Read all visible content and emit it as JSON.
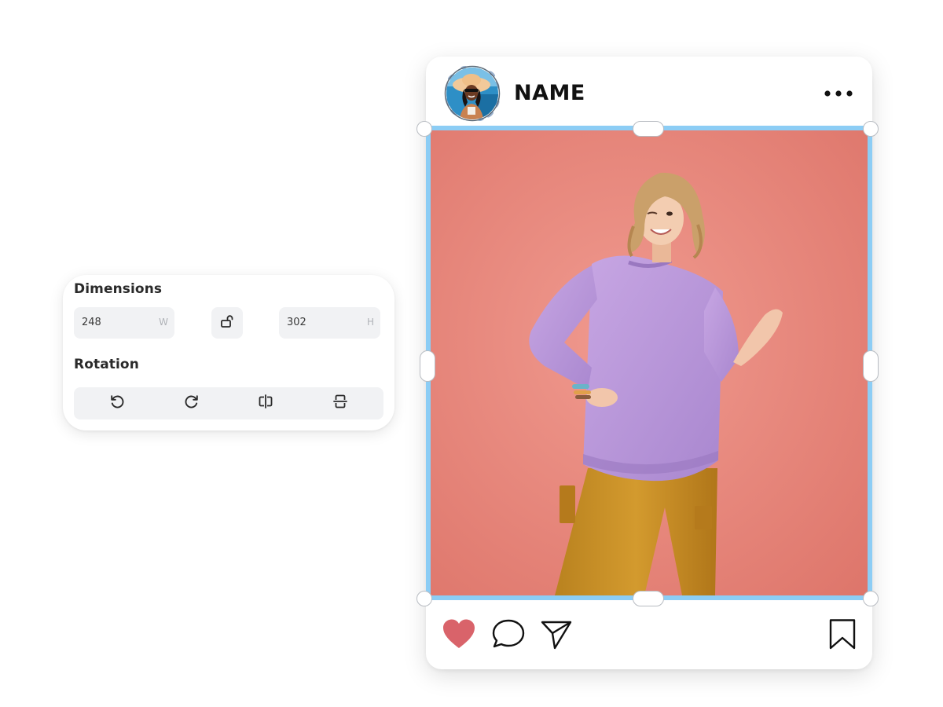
{
  "panel": {
    "dimensions_heading": "Dimensions",
    "width": {
      "value": "248",
      "unit": "W"
    },
    "height": {
      "value": "302",
      "unit": "H"
    },
    "lock_icon": "unlock-icon",
    "rotation_heading": "Rotation",
    "rotation_buttons": [
      {
        "icon": "rotate-left-icon"
      },
      {
        "icon": "rotate-right-icon"
      },
      {
        "icon": "flip-horizontal-icon"
      },
      {
        "icon": "flip-vertical-icon"
      }
    ]
  },
  "post": {
    "profile_name": "NAME",
    "avatar_icon": "profile-avatar",
    "more_icon": "more-dots-icon",
    "actions": [
      {
        "icon": "heart-icon",
        "state": "liked",
        "color": "#d9636a"
      },
      {
        "icon": "comment-icon"
      },
      {
        "icon": "share-icon"
      },
      {
        "icon": "bookmark-icon"
      }
    ],
    "selection_color": "#8ccdf5",
    "photo_background": "#e98c84"
  }
}
